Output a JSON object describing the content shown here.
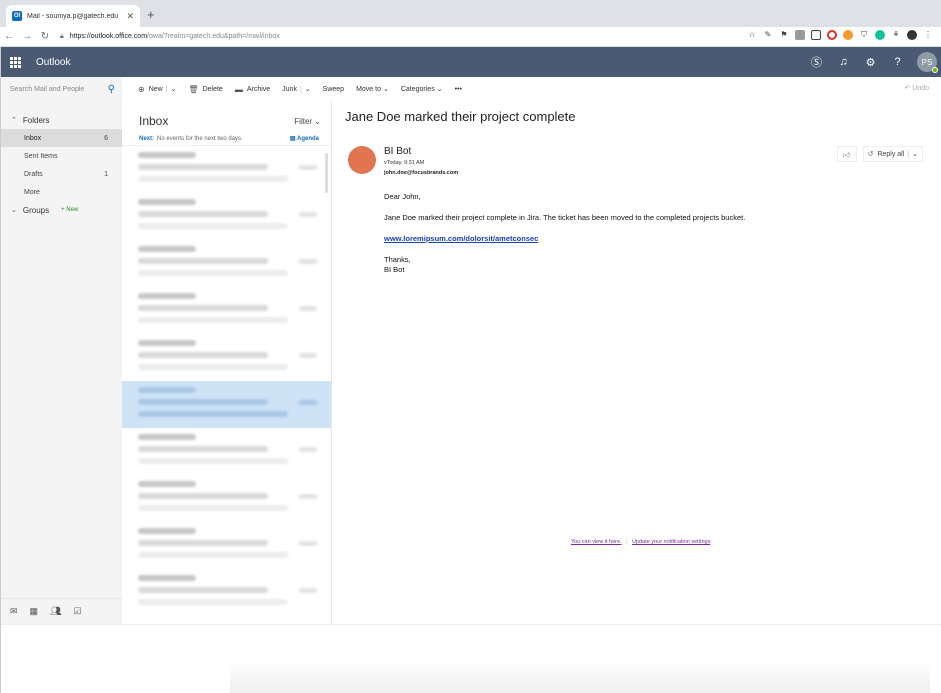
{
  "browser": {
    "tab_title": "Mail - soumya.p@gatech.edu",
    "tab_favicon": "Ol",
    "url_host": "https://outlook.office.com",
    "url_path": "/owa/?realm=gatech.edu&path=/mail/inbox"
  },
  "header": {
    "app_name": "Outlook",
    "avatar_initials": "PS"
  },
  "command_bar": {
    "search_placeholder": "Search Mail and People",
    "new": "New",
    "delete": "Delete",
    "archive": "Archive",
    "junk": "Junk",
    "sweep": "Sweep",
    "move_to": "Move to",
    "categories": "Categories",
    "more": "•••",
    "undo": "Undo"
  },
  "nav": {
    "folders_label": "Folders",
    "items": [
      {
        "label": "Inbox",
        "count": "6"
      },
      {
        "label": "Sent Items",
        "count": ""
      },
      {
        "label": "Drafts",
        "count": "1"
      },
      {
        "label": "More",
        "count": ""
      }
    ],
    "groups_label": "Groups",
    "groups_new": "+ New"
  },
  "message_list": {
    "title": "Inbox",
    "filter": "Filter",
    "next_label": "Next:",
    "next_text": "No events for the next two days.",
    "agenda": "Agenda"
  },
  "email": {
    "subject": "Jane Doe marked their project complete",
    "sender_name": "BI Bot",
    "time": "vToday, 9:31 AM",
    "to": "john.doe@focusbrands.com",
    "reply_all": "Reply all",
    "greeting": "Dear John,",
    "body_line": "Jane Doe marked their project complete in Jira. The ticket has been moved to the completed projects bucket.",
    "link": "www.loremipsum.com/dolorsit/ametconsec",
    "signoff_1": "Thanks,",
    "signoff_2": "BI Bot",
    "footer_link_1": "You can view it here.",
    "footer_link_2": "Update your notification settings"
  },
  "colors": {
    "header_bg": "#4a5a72",
    "accent": "#0f6cbd",
    "sender_avatar": "#e07550",
    "selected_row": "#cfe3f7"
  }
}
